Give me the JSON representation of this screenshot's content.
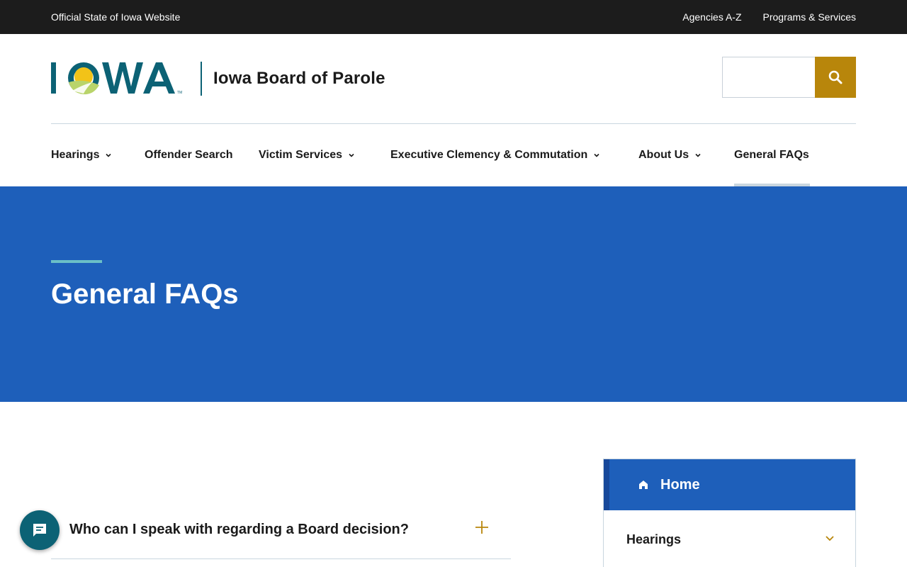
{
  "utility_bar": {
    "official_text": "Official State of Iowa Website",
    "links": [
      "Agencies A-Z",
      "Programs & Services"
    ]
  },
  "header": {
    "logo_text": "IOWA",
    "site_name": "Iowa Board of Parole",
    "search": {
      "value": "",
      "placeholder": ""
    }
  },
  "nav": {
    "items": [
      {
        "label": "Hearings",
        "has_dropdown": true
      },
      {
        "label": "Offender Search",
        "has_dropdown": false
      },
      {
        "label": "Victim Services",
        "has_dropdown": true
      },
      {
        "label": "Executive Clemency & Commutation",
        "has_dropdown": true
      },
      {
        "label": "About Us",
        "has_dropdown": true
      },
      {
        "label": "General FAQs",
        "has_dropdown": false,
        "active": true
      }
    ]
  },
  "hero": {
    "title": "General FAQs"
  },
  "faq": {
    "items": [
      {
        "question": "Who can I speak with regarding a Board decision?",
        "expanded": false
      }
    ]
  },
  "sidebar": {
    "home_label": "Home",
    "items": [
      {
        "label": "Hearings",
        "expanded": false
      }
    ]
  },
  "colors": {
    "utility_bg": "#1c1c1c",
    "hero_blue": "#1e5fba",
    "search_gold": "#b8860b",
    "logo_teal": "#0c6275",
    "accent_teal": "#6bbfc7"
  },
  "icons": {
    "search": "search-icon",
    "chat": "chat-icon",
    "home": "home-icon",
    "plus": "plus-icon",
    "chevron": "chevron-down-icon"
  }
}
